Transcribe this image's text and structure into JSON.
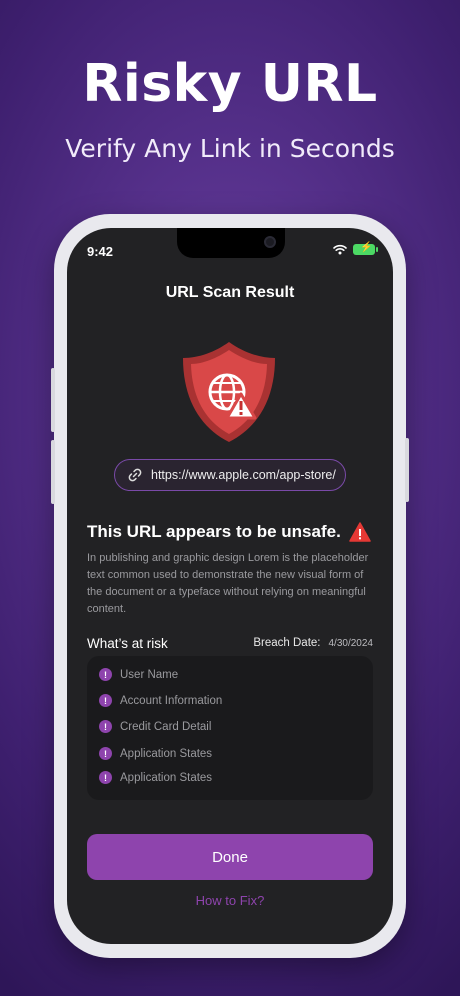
{
  "promo": {
    "title": "Risky URL",
    "subtitle": "Verify Any Link in Seconds"
  },
  "status_bar": {
    "time": "9:42"
  },
  "screen": {
    "title": "URL Scan Result",
    "url": "https://www.apple.com/app-store/",
    "unsafe_heading": "This URL appears to be unsafe.",
    "description": "In publishing and graphic design Lorem is the placeholder text common used to demonstrate the new visual form of the document or a typeface without relying on meaningful content.",
    "risk_label": "What’s at risk",
    "breach_label": "Breach Date:",
    "breach_date": "4/30/2024",
    "risk_items": [
      "User Name",
      "Account Information",
      "Credit Card Detail",
      "Application States",
      "Application States"
    ],
    "done_label": "Done",
    "fix_label": "How to Fix?"
  },
  "colors": {
    "accent": "#8e44ad",
    "danger": "#d94848",
    "screen_bg": "#222224"
  },
  "icons": [
    "shield-globe-warning-icon",
    "link-icon",
    "warning-triangle-icon",
    "alert-icon",
    "wifi-icon",
    "battery-icon"
  ]
}
